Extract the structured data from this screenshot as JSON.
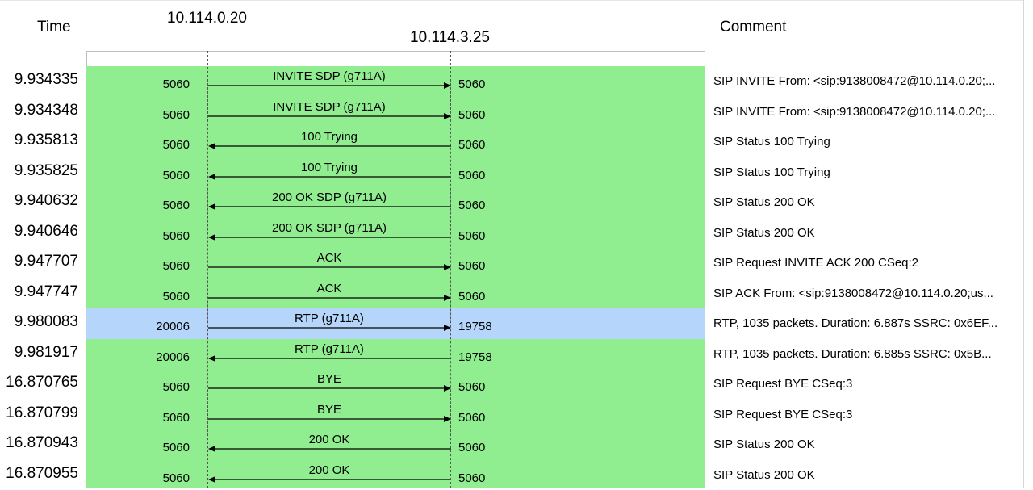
{
  "header": {
    "time_label": "Time",
    "addr_a": "10.114.0.20",
    "addr_b": "10.114.3.25",
    "comment_label": "Comment"
  },
  "colors": {
    "sip_band": "#90ee90",
    "rtp_highlight": "#b5d5fb"
  },
  "rows": [
    {
      "time": "9.934335",
      "port_a": "5060",
      "port_b": "5060",
      "label": "INVITE SDP (g711A)",
      "direction": "right",
      "comment": "SIP INVITE From: <sip:9138008472@10.114.0.20;..."
    },
    {
      "time": "9.934348",
      "port_a": "5060",
      "port_b": "5060",
      "label": "INVITE SDP (g711A)",
      "direction": "right",
      "comment": "SIP INVITE From: <sip:9138008472@10.114.0.20;..."
    },
    {
      "time": "9.935813",
      "port_a": "5060",
      "port_b": "5060",
      "label": "100 Trying",
      "direction": "left",
      "comment": "SIP Status 100 Trying"
    },
    {
      "time": "9.935825",
      "port_a": "5060",
      "port_b": "5060",
      "label": "100 Trying",
      "direction": "left",
      "comment": "SIP Status 100 Trying"
    },
    {
      "time": "9.940632",
      "port_a": "5060",
      "port_b": "5060",
      "label": "200 OK SDP (g711A)",
      "direction": "left",
      "comment": "SIP Status 200 OK"
    },
    {
      "time": "9.940646",
      "port_a": "5060",
      "port_b": "5060",
      "label": "200 OK SDP (g711A)",
      "direction": "left",
      "comment": "SIP Status 200 OK"
    },
    {
      "time": "9.947707",
      "port_a": "5060",
      "port_b": "5060",
      "label": "ACK",
      "direction": "right",
      "comment": "SIP Request INVITE ACK 200 CSeq:2"
    },
    {
      "time": "9.947747",
      "port_a": "5060",
      "port_b": "5060",
      "label": "ACK",
      "direction": "right",
      "comment": "SIP ACK From: <sip:9138008472@10.114.0.20;us..."
    },
    {
      "time": "9.980083",
      "port_a": "20006",
      "port_b": "19758",
      "label": "RTP (g711A)",
      "direction": "right",
      "comment": "RTP, 1035 packets. Duration: 6.887s SSRC: 0x6EF...",
      "selected": true
    },
    {
      "time": "9.981917",
      "port_a": "20006",
      "port_b": "19758",
      "label": "RTP (g711A)",
      "direction": "left",
      "comment": "RTP, 1035 packets. Duration: 6.885s SSRC: 0x5B..."
    },
    {
      "time": "16.870765",
      "port_a": "5060",
      "port_b": "5060",
      "label": "BYE",
      "direction": "right",
      "comment": "SIP Request BYE CSeq:3"
    },
    {
      "time": "16.870799",
      "port_a": "5060",
      "port_b": "5060",
      "label": "BYE",
      "direction": "right",
      "comment": "SIP Request BYE CSeq:3"
    },
    {
      "time": "16.870943",
      "port_a": "5060",
      "port_b": "5060",
      "label": "200 OK",
      "direction": "left",
      "comment": "SIP Status 200 OK"
    },
    {
      "time": "16.870955",
      "port_a": "5060",
      "port_b": "5060",
      "label": "200 OK",
      "direction": "left",
      "comment": "SIP Status 200 OK"
    }
  ]
}
